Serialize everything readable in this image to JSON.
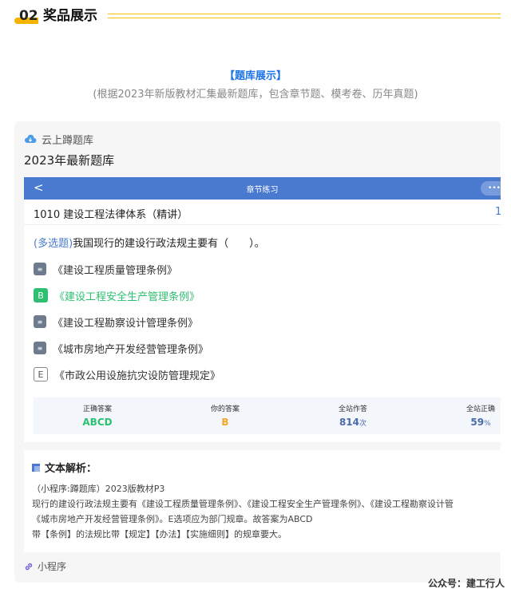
{
  "section": {
    "number": "02",
    "title": "奖品展示"
  },
  "intro": {
    "title": "【题库展示】",
    "desc": "(根据2023年新版教材汇集最新题库，包含章节题、模考卷、历年真题)"
  },
  "card": {
    "app_name": "云上蹲题库",
    "main_title": "2023年最新题库",
    "navbar": {
      "back": "<",
      "title": "章节练习",
      "more": "•••"
    },
    "chapter": {
      "name": "1010 建设工程法律体系（精讲）",
      "num": "1"
    },
    "question": {
      "type": "(多选题)",
      "text": "我国现行的建设行政法规主要有（　　）。"
    },
    "options": [
      {
        "badge": "≡",
        "text": "《建设工程质量管理条例》",
        "state": "chosen"
      },
      {
        "badge": "B",
        "text": "《建设工程安全生产管理条例》",
        "state": "correct"
      },
      {
        "badge": "≡",
        "text": "《建设工程勘察设计管理条例》",
        "state": "chosen"
      },
      {
        "badge": "≡",
        "text": "《城市房地产开发经营管理条例》",
        "state": "chosen"
      },
      {
        "badge": "E",
        "text": "《市政公用设施抗灾设防管理规定》",
        "state": "plain"
      }
    ],
    "stats": [
      {
        "label": "正确答案",
        "value": "ABCD",
        "unit": "",
        "color": "#2fbf71"
      },
      {
        "label": "你的答案",
        "value": "B",
        "unit": "",
        "color": "#f5a623"
      },
      {
        "label": "全站作答",
        "value": "814",
        "unit": "次",
        "color": "#4a6aa8"
      },
      {
        "label": "全站正确",
        "value": "59",
        "unit": "%",
        "color": "#4a6aa8"
      }
    ],
    "analysis": {
      "title": "文本解析：",
      "lines": [
        "（小程序:蹲题库）2023版教材P3",
        "现行的建设行政法规主要有《建设工程质量管理条例》、《建设工程安全生产管理条例》、《建设工程勘察设计管",
        "《城市房地产开发经营管理条例》。E选项应为部门规章。故答案为ABCD",
        "带【条例】的法规比带【规定】【办法】【实施细则】的规章要大。"
      ]
    },
    "mini_program": "小程序"
  },
  "footer": "公众号：建工行人",
  "colors": {
    "accent": "#4a7ad0",
    "yellow": "#f5b400",
    "correct": "#2fbf71"
  }
}
